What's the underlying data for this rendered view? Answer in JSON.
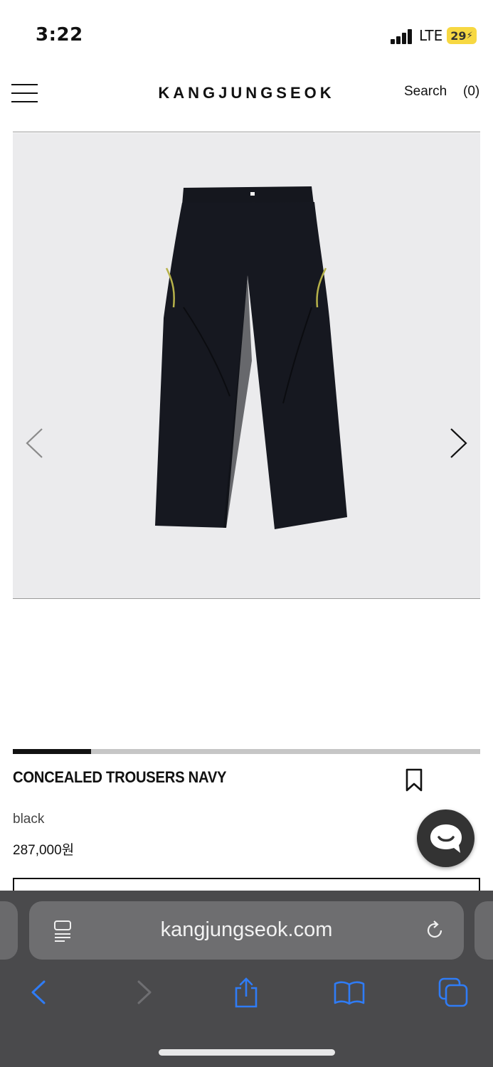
{
  "status_bar": {
    "time": "3:22",
    "network": "LTE",
    "battery": "29",
    "battery_color": "#f7d842"
  },
  "header": {
    "menu_icon": "hamburger-menu-icon",
    "logo": "KANGJUNGSEOK",
    "search_label": "Search",
    "cart_count": "(0)"
  },
  "carousel": {
    "image_subject": "navy-trousers-photo",
    "prev_icon": "chevron-left-icon",
    "next_icon": "chevron-right-icon",
    "progress": 0.167
  },
  "product": {
    "title": "CONCEALED TROUSERS NAVY",
    "color": "black",
    "price": "287,000원",
    "bookmark_icon": "bookmark-icon",
    "chat_icon": "chat-bubble-icon"
  },
  "browser": {
    "url": "kangjungseok.com",
    "reader_icon": "reader-icon",
    "reload_icon": "reload-icon",
    "toolbar": [
      "back-icon",
      "forward-icon",
      "share-icon",
      "bookmarks-icon",
      "tabs-icon"
    ],
    "accent": "#2f7cf6"
  }
}
